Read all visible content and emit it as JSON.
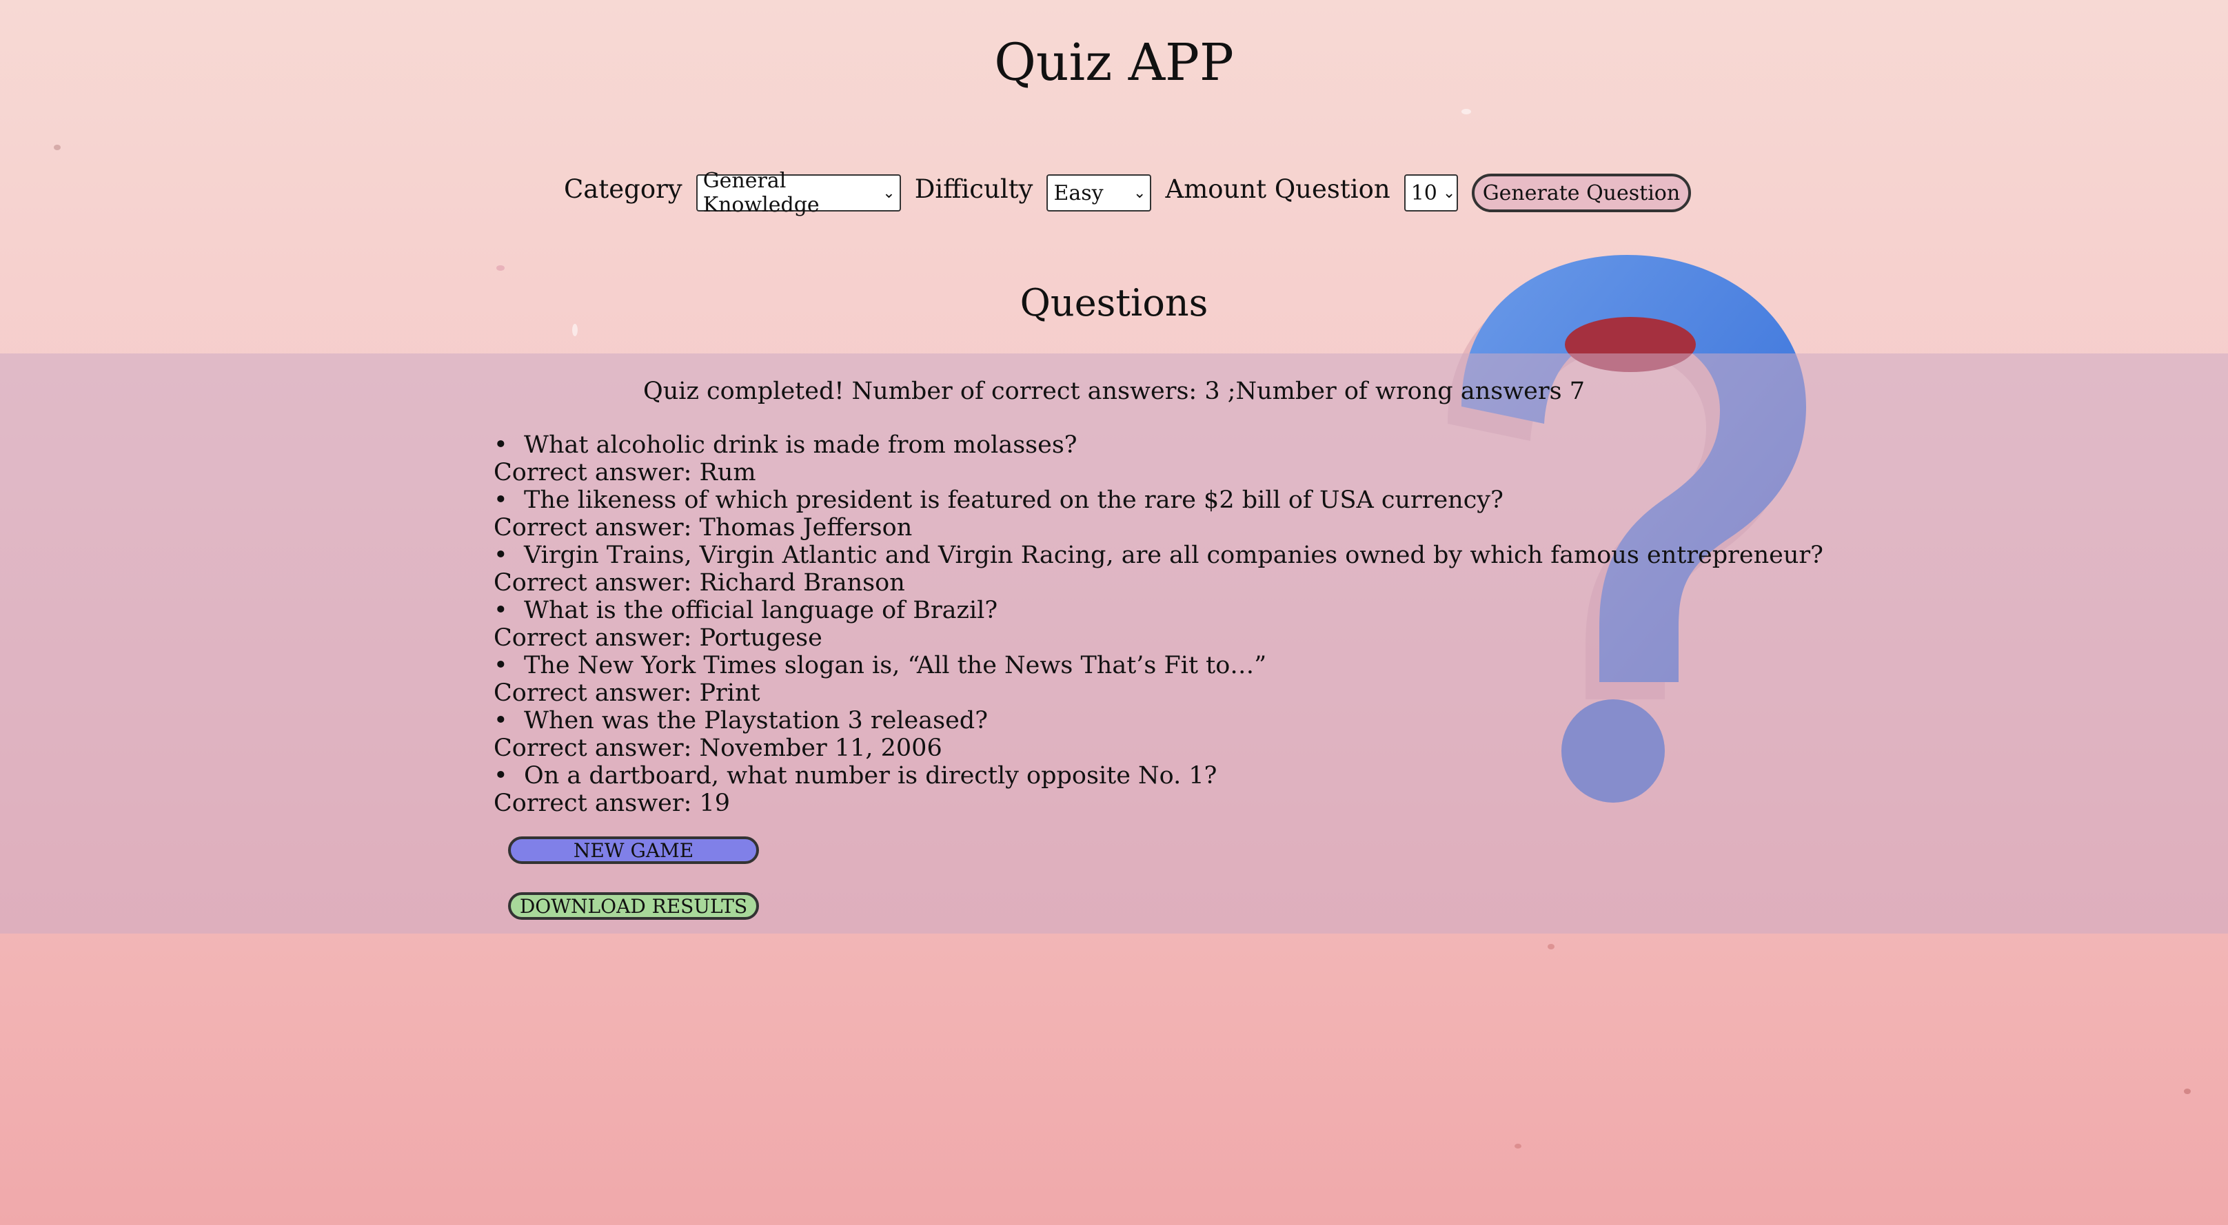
{
  "app": {
    "title": "Quiz APP"
  },
  "controls": {
    "category_label": "Category",
    "category_value": "General Knowledge",
    "difficulty_label": "Difficulty",
    "difficulty_value": "Easy",
    "amount_label": "Amount Question",
    "amount_value": "10",
    "generate_label": "Generate Question"
  },
  "questions": {
    "heading": "Questions",
    "summary_prefix": "Quiz completed! Number of correct answers: 3 ;Number of wrong answers 7",
    "items": [
      {
        "question": "What alcoholic drink is made from molasses?",
        "answer": "Correct answer: Rum"
      },
      {
        "question": "The likeness of which president is featured on the rare $2 bill of USA currency?",
        "answer": "Correct answer: Thomas Jefferson"
      },
      {
        "question": "Virgin Trains, Virgin Atlantic and Virgin Racing, are all companies owned by which famous entrepreneur?",
        "answer": "Correct answer: Richard Branson"
      },
      {
        "question": "What is the official language of Brazil?",
        "answer": "Correct answer: Portugese"
      },
      {
        "question": "The New York Times slogan is, “All the News That’s Fit to…”",
        "answer": "Correct answer: Print"
      },
      {
        "question": "When was the Playstation 3 released?",
        "answer": "Correct answer: November 11, 2006"
      },
      {
        "question": "On a dartboard, what number is directly opposite No. 1?",
        "answer": "Correct answer: 19"
      }
    ]
  },
  "actions": {
    "new_game": "NEW GAME",
    "download": "DOWNLOAD RESULTS"
  },
  "colors": {
    "new_game_bg": "#8080e8",
    "download_bg": "#a8d89a",
    "generate_bg": "#e8bcc6",
    "band": "#d9b0c2"
  },
  "decor": {
    "background_icon": "question-mark-icon"
  }
}
